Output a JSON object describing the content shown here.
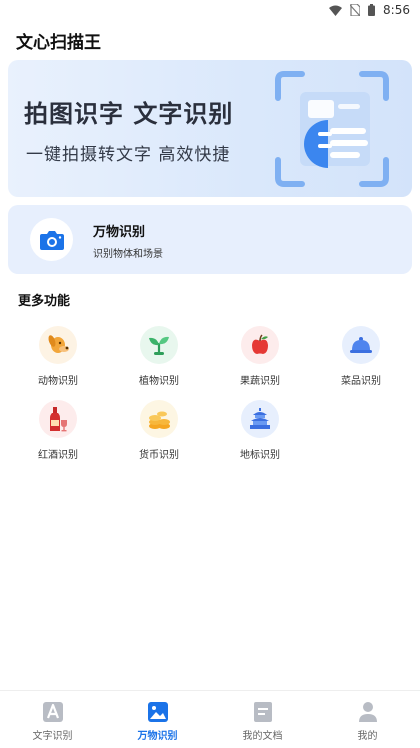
{
  "status": {
    "time": "8:56"
  },
  "app": {
    "title": "文心扫描王"
  },
  "banner": {
    "title": "拍图识字  文字识别",
    "subtitle": "一键拍摄转文字  高效快捷"
  },
  "feature": {
    "title": "万物识别",
    "subtitle": "识别物体和场景"
  },
  "more": {
    "title": "更多功能",
    "items": [
      {
        "label": "动物识别",
        "icon": "dog-icon"
      },
      {
        "label": "植物识别",
        "icon": "sprout-icon"
      },
      {
        "label": "果蔬识别",
        "icon": "apple-icon"
      },
      {
        "label": "菜品识别",
        "icon": "cloche-icon"
      },
      {
        "label": "红酒识别",
        "icon": "wine-icon"
      },
      {
        "label": "货币识别",
        "icon": "coins-icon"
      },
      {
        "label": "地标识别",
        "icon": "temple-icon"
      }
    ]
  },
  "tabs": [
    {
      "label": "文字识别",
      "active": false
    },
    {
      "label": "万物识别",
      "active": true
    },
    {
      "label": "我的文档",
      "active": false
    },
    {
      "label": "我的",
      "active": false
    }
  ],
  "colors": {
    "accent": "#1b73e8",
    "bannerBg": "#dae8fb",
    "cardBg": "#e7effd"
  }
}
